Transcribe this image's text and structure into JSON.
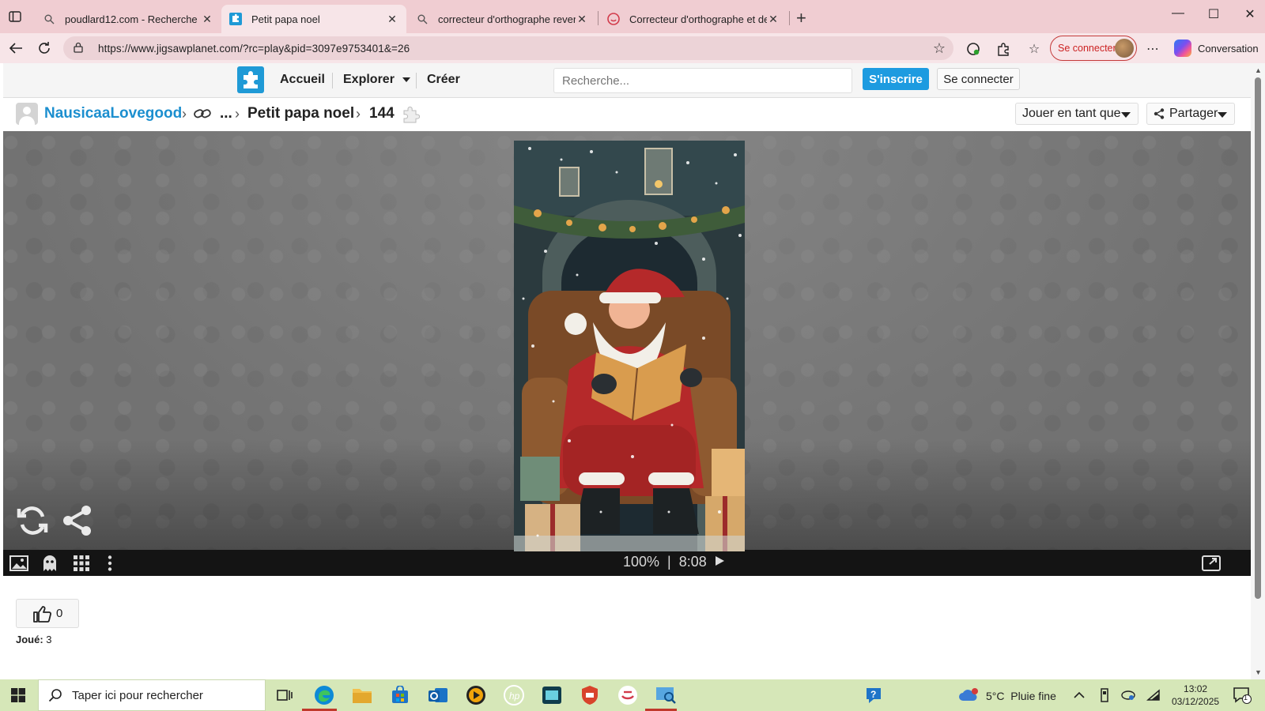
{
  "browser": {
    "tabs": [
      {
        "title": "poudlard12.com - Recherche",
        "active": false
      },
      {
        "title": "Petit papa noel",
        "active": true
      },
      {
        "title": "correcteur d'orthographe reverso",
        "active": false
      },
      {
        "title": "Correcteur d'orthographe et de g",
        "active": false
      }
    ],
    "url": "https://www.jigsawplanet.com/?rc=play&pid=3097e9753401&=26",
    "signin_label": "Se connecter",
    "copilot_label": "Conversation"
  },
  "site": {
    "nav": {
      "home": "Accueil",
      "explore": "Explorer",
      "create": "Créer",
      "search_placeholder": "Recherche...",
      "signup": "S'inscrire",
      "login": "Se connecter"
    },
    "breadcrumb": {
      "user": "NausicaaLovegood",
      "ellipsis": "...",
      "puzzle_title": "Petit papa noel",
      "piece_count": "144"
    },
    "play_as": "Jouer en tant que",
    "share": "Partager"
  },
  "puzzle": {
    "zoom": "100%",
    "separator": "|",
    "timer": "8:08"
  },
  "stats": {
    "likes": "0",
    "played_label": "Joué:",
    "played_count": "3"
  },
  "taskbar": {
    "search_placeholder": "Taper ici pour rechercher",
    "weather_temp": "5°C",
    "weather_desc": "Pluie fine",
    "time": "13:02",
    "date": "03/12/2025",
    "notification_count": "1"
  },
  "colors": {
    "tab_strip": "#f0cdd2",
    "brand_blue": "#1d9be0",
    "user_link": "#1c8fcf",
    "taskbar": "#d6e7b8"
  }
}
